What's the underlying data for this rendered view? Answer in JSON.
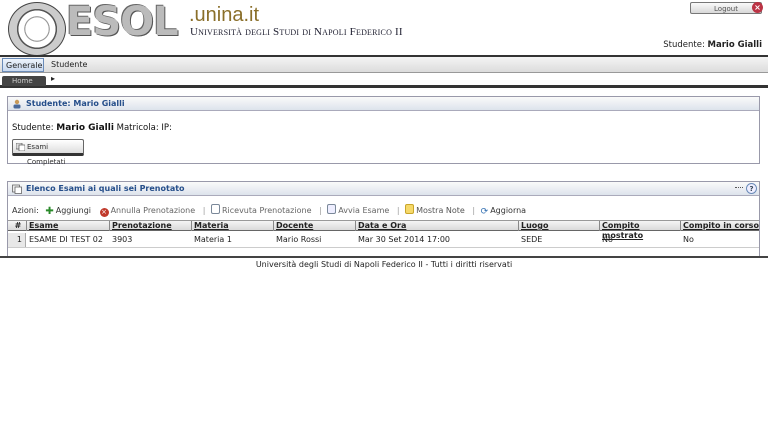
{
  "header": {
    "logo_text": "ESOL",
    "site_suffix": ".unina.it",
    "university": "Università degli Studi di Napoli Federico II",
    "logout_label": "Logout",
    "student_label": "Studente:",
    "student_name": "Mario Gialli"
  },
  "menu": {
    "items": [
      {
        "label": "Generale ▾"
      },
      {
        "label": "Studente ▸"
      }
    ]
  },
  "tabs": [
    {
      "label": "Home"
    }
  ],
  "student_panel": {
    "title": "Studente: Mario Gialli",
    "info_label": "Studente:",
    "info_name": "Mario Gialli",
    "info_rest": "Matricola:  IP:",
    "button_label": "Esami Completati"
  },
  "exams_panel": {
    "title": "Elenco Esami ai quali sei Prenotato",
    "actions_label": "Azioni:",
    "actions": [
      {
        "label": "Aggiungi",
        "color": "#2a8a2a"
      },
      {
        "label": "Annulla Prenotazione",
        "color": "#c0392b"
      },
      {
        "label": "Ricevuta Prenotazione",
        "color": "#7a8899"
      },
      {
        "label": "Avvia Esame",
        "color": "#7a8899"
      },
      {
        "label": "Mostra Note",
        "color": "#e8c23a"
      },
      {
        "label": "Aggiorna",
        "color": "#2f6db0"
      }
    ],
    "columns": [
      "#",
      "Esame",
      "Prenotazione",
      "Materia",
      "Docente",
      "Data e Ora",
      "Luogo",
      "Compito mostrato",
      "Compito in corso"
    ],
    "rows": [
      [
        "1",
        "ESAME DI TEST 02",
        "3903",
        "Materia 1",
        "Mario Rossi",
        "Mar 30 Set 2014 17:00",
        "SEDE",
        "No",
        "No"
      ]
    ]
  },
  "footer": "Università degli Studi di Napoli Federico II - Tutti i diritti riservati"
}
